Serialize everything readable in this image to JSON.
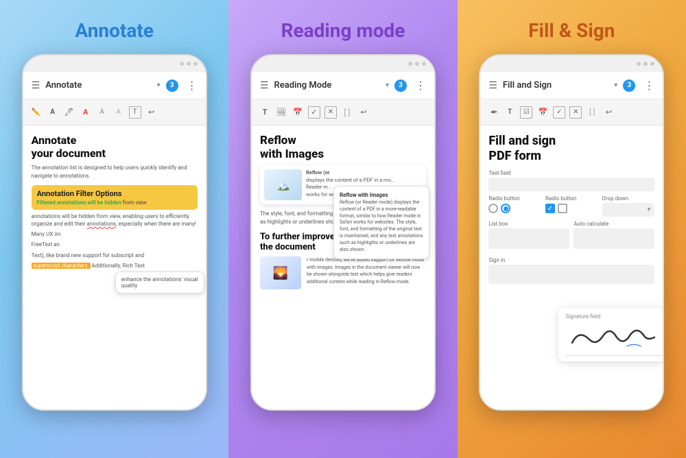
{
  "panels": [
    {
      "id": "annotate",
      "title": "Annotate",
      "titleColor": "#2a7fd4",
      "phone": {
        "header_title": "Annotate",
        "badge": "3",
        "doc_title": "Annotate\nyour document",
        "doc_body1": "The annotation list is designed to help users quickly identify and navigate to annotations.",
        "filter_title": "Annotation Filter Options",
        "filter_sub_green": "Filtered annotations will be hidden",
        "filter_sub_rest": " from view",
        "doc_body2": "annotations will be hidden from view, enabling users to efficiently organize and edit their",
        "doc_link": "annotations",
        "doc_body3": ", especially when there are many!",
        "doc_body4": "Many UX im",
        "tooltip_text": "enhance the annotations' visual quality",
        "doc_body5": "FreeText an",
        "doc_body6": "Text), like brand new support for subscript and",
        "highlight_text": "superscript characters.",
        "doc_body7": " Additionally, Rich Text"
      }
    },
    {
      "id": "reading",
      "title": "Reading mode",
      "titleColor": "#7a40c8",
      "phone": {
        "header_title": "Reading Mode",
        "badge": "3",
        "main_header": "Reflow\nwith Images",
        "body1": "The style, font, and formatting text is maintained, and any text such as highlights or underlines shown.",
        "card_title": "Reflow (or",
        "card_body": "displays the content of a PDF in a more-readable format, similar to how Reader mode works for websites.",
        "tooltip_title": "Reflow with Images",
        "tooltip_body": "Reflow (or Reader mode) displays the content of a PDF in a more-readable format, similar to how Reader mode in Safari works for websites. The style, font, and formatting of the original text is maintained, and any text annotations such as highlights or underlines are also shown.",
        "sub_header": "To further improve\nthe document",
        "sub_body": "r mobile devices, we've added support for Reflow mode with images. Images in the document viewer will now be shown alongside text which helps give readers additional context while reading in Reflow mode."
      }
    },
    {
      "id": "sign",
      "title": "Fill & Sign",
      "titleColor": "#c05818",
      "phone": {
        "header_title": "Fill and Sign",
        "badge": "3",
        "form_title": "Fill and sign\nPDF form",
        "text_field_label": "Text field",
        "radio1_label": "Radio button",
        "radio2_label": "Radio button",
        "dropdown_label": "Drop down",
        "listbox_label": "List box",
        "autocalc_label": "Auto calculate",
        "signature_field_label": "Signature field",
        "sign_label": "Sign in",
        "signature_scribble": "Thoum"
      }
    }
  ]
}
